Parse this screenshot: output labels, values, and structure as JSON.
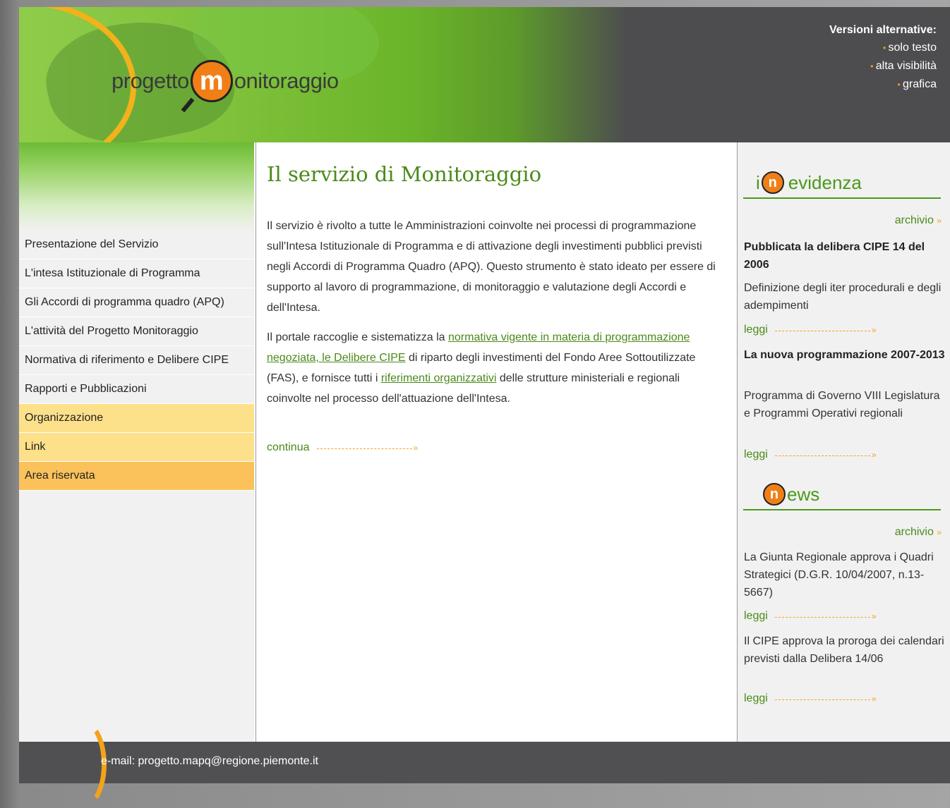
{
  "header": {
    "logo_left": "progetto",
    "logo_m": "m",
    "logo_right": "onitoraggio",
    "alt_title": "Versioni alternative:",
    "alt_links": [
      "solo testo",
      "alta visibilità",
      "grafica"
    ]
  },
  "nav": {
    "items": [
      "Presentazione del Servizio",
      "L'intesa Istituzionale di Programma",
      "Gli Accordi di programma quadro (APQ)",
      "L'attività del Progetto Monitoraggio",
      "Normativa di riferimento e Delibere CIPE",
      "Rapporti e Pubblicazioni",
      "Organizzazione",
      "Link",
      "Area riservata"
    ]
  },
  "main": {
    "title": "Il servizio di Monitoraggio",
    "p1": "Il servizio è rivolto a tutte le Amministrazioni coinvolte nei processi di programmazione sull'Intesa Istituzionale di Programma e di attivazione degli investimenti pubblici previsti negli Accordi di Programma Quadro (APQ). Questo strumento è stato ideato per essere di supporto al lavoro di programmazione, di monitoraggio e valutazione degli Accordi e dell'Intesa.",
    "p2_a": "Il portale raccoglie e sistematizza la ",
    "p2_link1": "normativa vigente in materia di programmazione negoziata, le Delibere CIPE",
    "p2_b": " di riparto degli investimenti del Fondo Aree Sottoutilizzate (FAS), e fornisce tutti i ",
    "p2_link2": "riferimenti organizzativi",
    "p2_c": " delle strutture ministeriali e regionali coinvolte nel processo dell'attuazione dell'Intesa.",
    "continua": "continua"
  },
  "evidenza": {
    "pre": "i",
    "title": "evidenza",
    "archivio": "archivio",
    "items": [
      {
        "title": "Pubblicata la delibera CIPE 14 del 2006",
        "text": "Definizione degli iter procedurali e degli adempimenti",
        "leggi": "leggi"
      },
      {
        "title": "La nuova programmazione 2007-2013",
        "text": "Programma di Governo VIII Legislatura e Programmi Operativi regionali",
        "leggi": "leggi"
      }
    ]
  },
  "news": {
    "title": "ews",
    "archivio": "archivio",
    "items": [
      {
        "text": "La Giunta Regionale approva i Quadri Strategici (D.G.R. 10/04/2007, n.13-5667)",
        "leggi": "leggi"
      },
      {
        "text": "Il CIPE approva la proroga dei calendari previsti dalla Delibera 14/06",
        "leggi": "leggi"
      }
    ]
  },
  "footer": {
    "email": "e-mail: progetto.mapq@regione.piemonte.it"
  },
  "colors": {
    "accent_green": "#4a8a1a",
    "accent_orange": "#f2a31b",
    "header_dark": "#4d4d4f"
  }
}
